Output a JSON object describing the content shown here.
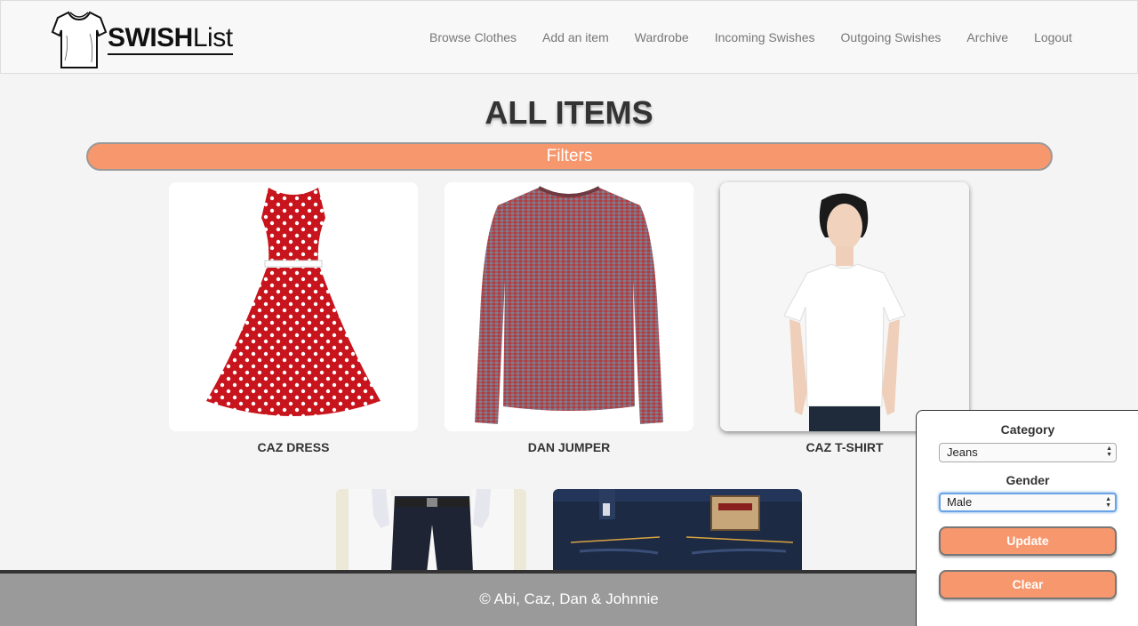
{
  "brand": {
    "logo_bold": "SWISH",
    "logo_light": "List"
  },
  "nav": [
    {
      "label": "Browse Clothes"
    },
    {
      "label": "Add an item"
    },
    {
      "label": "Wardrobe"
    },
    {
      "label": "Incoming Swishes"
    },
    {
      "label": "Outgoing Swishes"
    },
    {
      "label": "Archive"
    },
    {
      "label": "Logout"
    }
  ],
  "main": {
    "title": "ALL ITEMS",
    "filters_label": "Filters",
    "items": [
      {
        "name": "CAZ DRESS",
        "icon": "red-polka-dot-dress-image"
      },
      {
        "name": "DAN JUMPER",
        "icon": "knit-jumper-image"
      },
      {
        "name": "CAZ T-SHIRT",
        "icon": "white-tshirt-model-image"
      }
    ],
    "items_row2": [
      {
        "icon": "dark-trousers-image"
      },
      {
        "icon": "denim-jeans-image"
      }
    ]
  },
  "filter_panel": {
    "category_label": "Category",
    "category_value": "Jeans",
    "gender_label": "Gender",
    "gender_value": "Male",
    "update_label": "Update",
    "clear_label": "Clear"
  },
  "footer": {
    "text": "© Abi, Caz, Dan & Johnnie"
  },
  "colors": {
    "accent": "#f7976d",
    "footer_bg": "#9a9a9a"
  }
}
